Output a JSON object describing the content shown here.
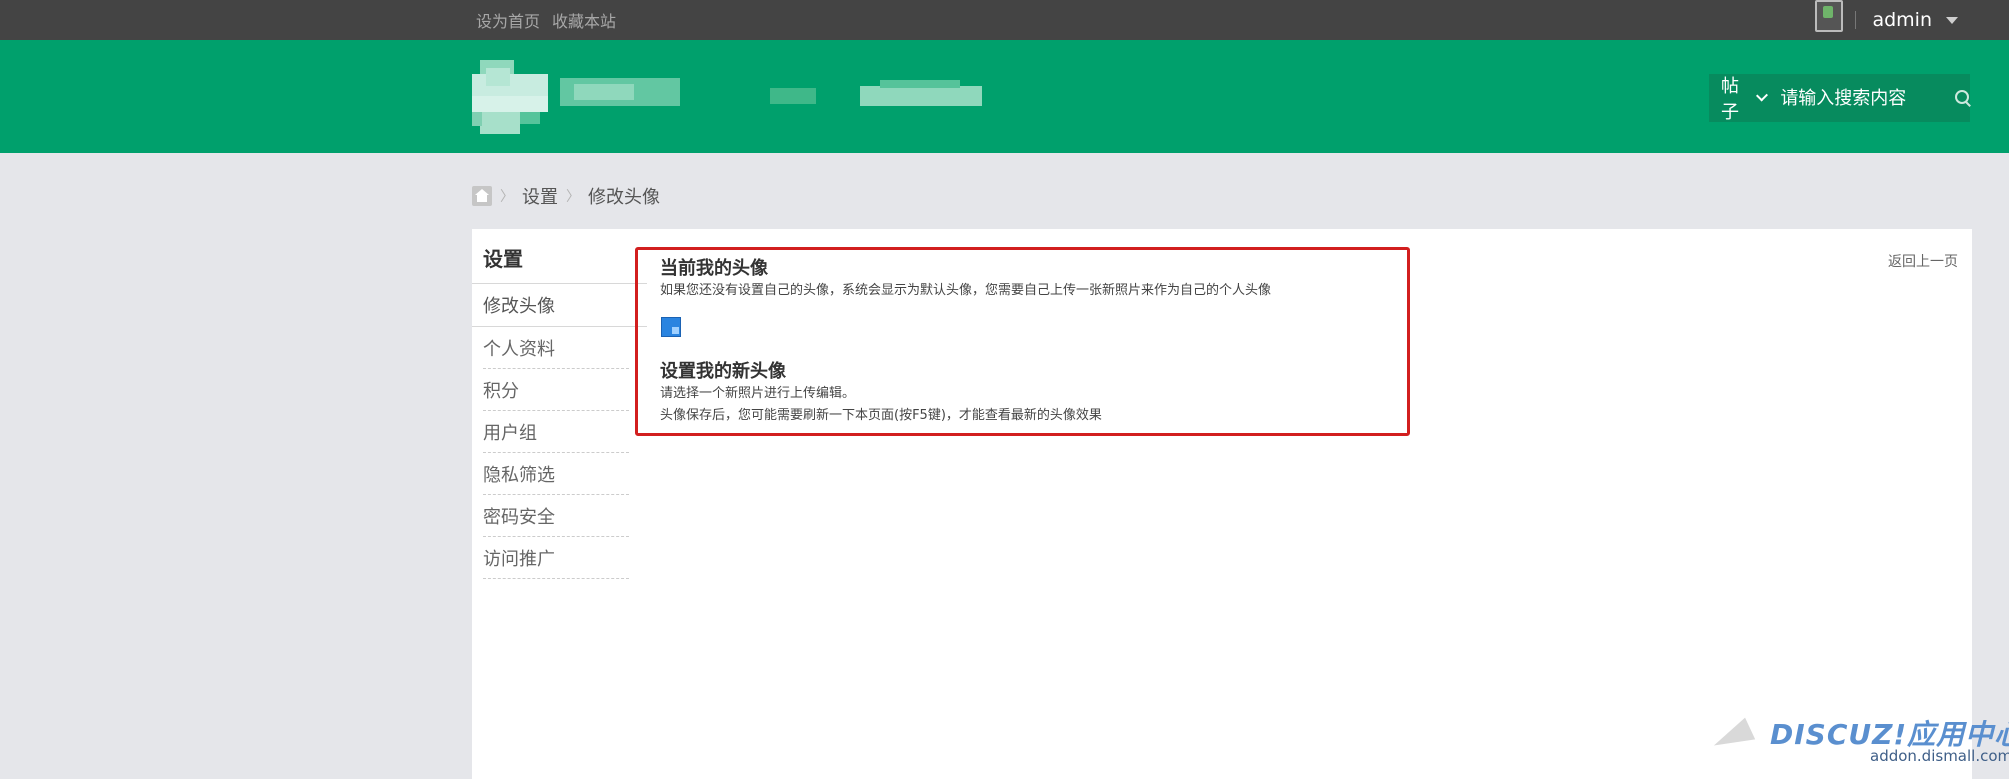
{
  "topbar": {
    "links": [
      "设为首页",
      "收藏本站"
    ],
    "username": "admin"
  },
  "header": {
    "search": {
      "type_label": "帖子",
      "placeholder": "请输入搜索内容"
    }
  },
  "breadcrumb": {
    "items": [
      "设置",
      "修改头像"
    ]
  },
  "sidebar": {
    "title": "设置",
    "items": [
      "修改头像",
      "个人资料",
      "积分",
      "用户组",
      "隐私筛选",
      "密码安全",
      "访问推广"
    ]
  },
  "main": {
    "back_label": "返回上一页",
    "current_avatar_title": "当前我的头像",
    "current_avatar_desc": "如果您还没有设置自己的头像，系统会显示为默认头像，您需要自己上传一张新照片来作为自己的个人头像",
    "new_avatar_title": "设置我的新头像",
    "new_avatar_desc1": "请选择一个新照片进行上传编辑。",
    "new_avatar_desc2": "头像保存后，您可能需要刷新一下本页面(按F5键)，才能查看最新的头像效果"
  },
  "watermark": {
    "brand": "DISCUZ!应用中心",
    "url": "addon.dismall.com"
  },
  "colors": {
    "topbar": "#444444",
    "header": "#00a06c",
    "highlight_border": "#d21f1f"
  }
}
